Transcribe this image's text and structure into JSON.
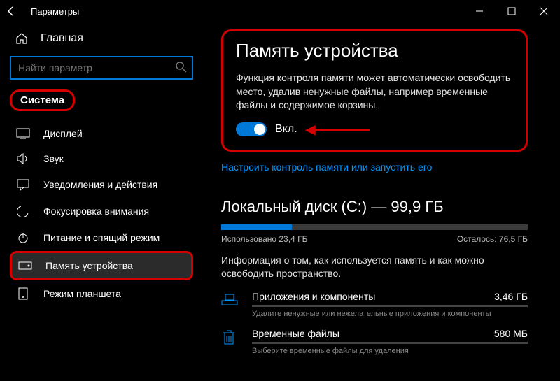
{
  "window": {
    "title": "Параметры"
  },
  "home_label": "Главная",
  "search": {
    "placeholder": "Найти параметр"
  },
  "category": "Система",
  "nav": {
    "display": "Дисплей",
    "sound": "Звук",
    "notifications": "Уведомления и действия",
    "focus": "Фокусировка внимания",
    "power": "Питание и спящий режим",
    "storage": "Память устройства",
    "tablet": "Режим планшета"
  },
  "page": {
    "title": "Память устройства",
    "desc": "Функция контроля памяти может автоматически освободить место, удалив ненужные файлы, например временные файлы и содержимое корзины.",
    "toggle_label": "Вкл.",
    "configure_link": "Настроить контроль памяти или запустить его",
    "disk_title": "Локальный диск (C:) — 99,9 ГБ",
    "used_label": "Использовано 23,4 ГБ",
    "left_label": "Осталось: 76,5 ГБ",
    "used_percent": 23,
    "hint": "Информация о том, как используется память и как можно освободить пространство.",
    "items": [
      {
        "name": "Приложения и компоненты",
        "size": "3,46 ГБ",
        "sub": "Удалите ненужные или нежелательные приложения и компоненты"
      },
      {
        "name": "Временные файлы",
        "size": "580 МБ",
        "sub": "Выберите временные файлы для удаления"
      }
    ]
  }
}
